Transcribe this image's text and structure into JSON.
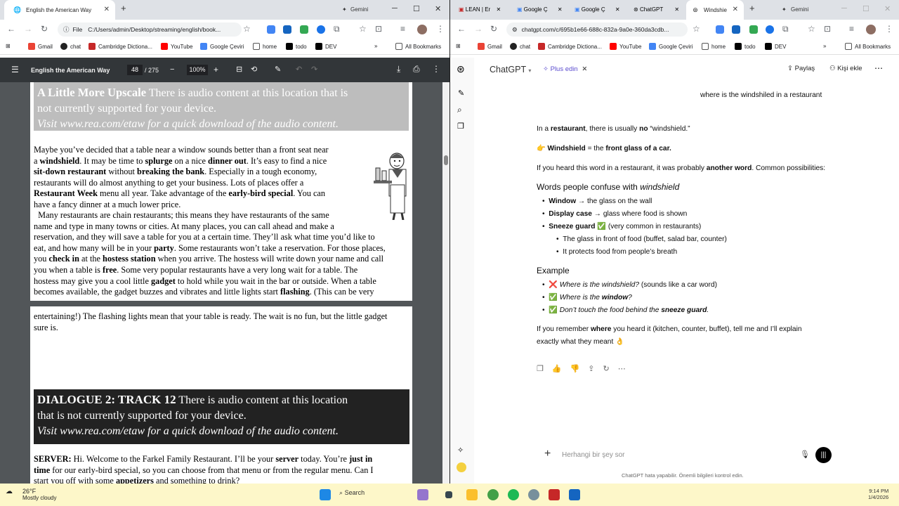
{
  "left_window": {
    "tab_title": "English the American Way",
    "profile_label": "Gemini",
    "address": "C:/Users/admin/Desktop/streaming/english/book...",
    "address_prefix": "File",
    "bookmarks": [
      "Gmail",
      "chat",
      "Cambridge Dictiona...",
      "YouTube",
      "Google Çeviri",
      "home",
      "todo",
      "DEV"
    ],
    "all_bookmarks": "All Bookmarks",
    "pdf": {
      "title": "English the American Way",
      "page_current": "48",
      "page_total": "/ 275",
      "zoom": "100%",
      "audio_heading_1": "A Little More Upscale",
      "audio_line_1a": "There is audio content at this location that is",
      "audio_line_1b": "not currently supported for your device.",
      "audio_line_1c": "Visit www.rea.com/etaw for a quick download of the audio content.",
      "para1": [
        "Maybe you’ve decided that a table near a window sounds better than a front seat near",
        "a |windshield|. It may be time to |splurge| on a nice |dinner out|. It’s easy to find a nice",
        "|sit-down restaurant| without |breaking the bank|. Especially in a tough economy,",
        "restaurants will do almost anything to get your business. Lots of places offer a",
        "|Restaurant Week| menu all year. Take advantage of the |early-bird special|. You can",
        "have a fancy dinner at a much lower price."
      ],
      "para2": [
        "  Many restaurants are chain restaurants; this means they have restaurants of the same",
        "name and type in many towns or cities. At many places, you can call ahead and make a",
        "reservation, and they will save a table for you at a certain time. They’ll ask what time you’d like to",
        "eat, and how many will be in your |party|. Some restaurants won’t take a reservation. For those places,",
        "you |check in| at the |hostess station| when you arrive. The hostess will write down your name and call",
        "you when a table is |free|. Some very popular restaurants have a very long wait for a table. The",
        "hostess may give you a cool little |gadget| to hold while you wait in the bar or outside. When a table",
        "becomes available, the gadget buzzes and vibrates and little lights start |flashing|. (This can be very"
      ],
      "para3": [
        "entertaining!) The flashing lights mean that your table is ready. The wait is no fun, but the little gadget",
        "sure is."
      ],
      "audio_heading_2": "DIALOGUE 2: TRACK 12",
      "audio_line_2a": "There is audio content at this location",
      "audio_line_2b": "that is not currently supported for your device.",
      "audio_line_2c": "Visit www.rea.com/etaw for a quick download of the audio content.",
      "para4": [
        "|SERVER:| Hi. Welcome to the Farkel Family Restaurant. I’ll be your |server| today. You’re |just in",
        "|time| for our early-bird special, so you can choose from that menu or from the regular menu. Can I",
        "start you off with some |appetizers| and something to drink?"
      ]
    }
  },
  "right_window": {
    "tabs": [
      "LEAN | Er",
      "Google Ç",
      "Google Ç",
      "ChatGPT",
      "Windshie"
    ],
    "profile_label": "Gemini",
    "address": "chatgpt.com/c/695b1e66-688c-832a-9a0e-360da3cdb...",
    "bookmarks": [
      "Gmail",
      "chat",
      "Cambridge Dictiona...",
      "YouTube",
      "Google Çeviri",
      "home",
      "todo",
      "DEV"
    ],
    "all_bookmarks": "All Bookmarks",
    "chat": {
      "model": "ChatGPT",
      "plus": "Plus edin",
      "share": "Paylaş",
      "add_person": "Kişi ekle",
      "user_message": "where is the windshiled in a restaurant",
      "answer_p1": [
        "In a ",
        "restaurant",
        ", there is usually ",
        "no",
        " “windshield.”"
      ],
      "answer_p2": [
        "Windshield",
        " = the ",
        "front glass of a car."
      ],
      "answer_p3": [
        "If you heard this word in a restaurant, it was probably ",
        "another word",
        ". Common possibilities:"
      ],
      "heading": "Words people confuse with ",
      "heading_em": "windshield",
      "list": [
        {
          "bold": "Window",
          "rest": " → the glass on the wall"
        },
        {
          "bold": "Display case",
          "rest": " → glass where food is shown"
        },
        {
          "bold": "Sneeze guard",
          "rest": " ✅ (very common in restaurants)"
        }
      ],
      "sublist": [
        "The glass in front of food (buffet, salad bar, counter)",
        "It protects food from people’s breath"
      ],
      "example_heading": "Example",
      "examples": [
        {
          "mark": "❌",
          "text": "Where is the windshield?",
          "rest": " (sounds like a car word)"
        },
        {
          "mark": "✅",
          "text": "Where is the ",
          "em": "window",
          "tail": "?"
        },
        {
          "mark": "✅",
          "text": "Don’t touch the food behind the ",
          "em": "sneeze guard",
          "tail": "."
        }
      ],
      "closing_1": "If you remember ",
      "closing_bold": "where",
      "closing_2": " you heard it (kitchen, counter, buffet), tell me and I’ll explain",
      "closing_3": "exactly what they meant 👌",
      "input_placeholder": "Herhangi bir şey sor",
      "disclaimer": "ChatGPT hata yapabilir. Önemli bilgileri kontrol edin."
    }
  },
  "taskbar": {
    "temperature": "26°F",
    "weather": "Mostly cloudy",
    "search": "Search",
    "time": "9:14 PM",
    "date": "1/4/2026"
  }
}
